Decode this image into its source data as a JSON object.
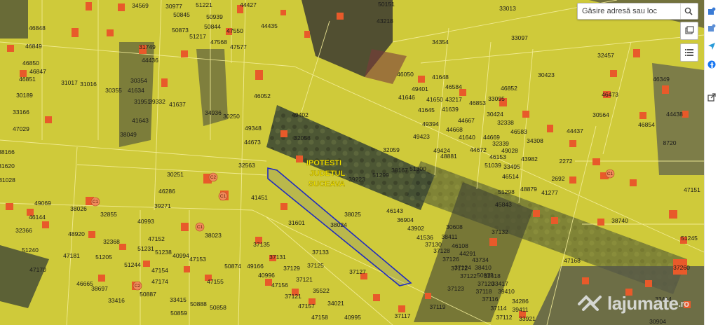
{
  "search": {
    "placeholder": "Găsire adresă sau loc"
  },
  "toolbar": {
    "search_icon": "search-icon",
    "layers_icon": "layers-icon",
    "list_icon": "list-icon"
  },
  "side_strip": {
    "icons": [
      "puzzle-icon",
      "send-icon",
      "facebook-icon",
      "external-link-icon"
    ]
  },
  "map": {
    "place_label": [
      "IPOTESTI",
      "JUDETUL",
      "SUCEAVA"
    ],
    "highlight_parcel": "31601",
    "highlight_color": "#1f2bbf",
    "parcel_fill": "#e8e43a",
    "parcel_line": "#fbf6a0",
    "building_color": "#e85a2a",
    "parcels": [
      {
        "id": "34569"
      },
      {
        "id": "30977"
      },
      {
        "id": "51221"
      },
      {
        "id": "44427"
      },
      {
        "id": "50151"
      },
      {
        "id": "33013"
      },
      {
        "id": "50845"
      },
      {
        "id": "50939"
      },
      {
        "id": "43218"
      },
      {
        "id": "46848"
      },
      {
        "id": "50873"
      },
      {
        "id": "50844"
      },
      {
        "id": "47550"
      },
      {
        "id": "44435"
      },
      {
        "id": "51217"
      },
      {
        "id": "33097"
      },
      {
        "id": "46849"
      },
      {
        "id": "47568"
      },
      {
        "id": "47577"
      },
      {
        "id": "34354"
      },
      {
        "id": "31749"
      },
      {
        "id": "32457"
      },
      {
        "id": "46850"
      },
      {
        "id": "44436"
      },
      {
        "id": "30423"
      },
      {
        "id": "46847"
      },
      {
        "id": "46050"
      },
      {
        "id": "41648"
      },
      {
        "id": "46349"
      },
      {
        "id": "46851"
      },
      {
        "id": "31017"
      },
      {
        "id": "31016"
      },
      {
        "id": "30354"
      },
      {
        "id": "41634"
      },
      {
        "id": "46584"
      },
      {
        "id": "46852"
      },
      {
        "id": "30189"
      },
      {
        "id": "30355"
      },
      {
        "id": "31951"
      },
      {
        "id": "46052"
      },
      {
        "id": "49401"
      },
      {
        "id": "41646"
      },
      {
        "id": "41650"
      },
      {
        "id": "43217"
      },
      {
        "id": "33095"
      },
      {
        "id": "46473"
      },
      {
        "id": "39332"
      },
      {
        "id": "41637"
      },
      {
        "id": "46853"
      },
      {
        "id": "33166"
      },
      {
        "id": "34936"
      },
      {
        "id": "30250"
      },
      {
        "id": "49402"
      },
      {
        "id": "41645"
      },
      {
        "id": "41639"
      },
      {
        "id": "30424"
      },
      {
        "id": "30564"
      },
      {
        "id": "44438"
      },
      {
        "id": "41643"
      },
      {
        "id": "44667"
      },
      {
        "id": "32338"
      },
      {
        "id": "46854"
      },
      {
        "id": "47029"
      },
      {
        "id": "49348"
      },
      {
        "id": "49394"
      },
      {
        "id": "44668"
      },
      {
        "id": "46583"
      },
      {
        "id": "44437"
      },
      {
        "id": "38049"
      },
      {
        "id": "32058"
      },
      {
        "id": "49423"
      },
      {
        "id": "41640"
      },
      {
        "id": "44669"
      },
      {
        "id": "34308"
      },
      {
        "id": "44673"
      },
      {
        "id": "32339"
      },
      {
        "id": "8720"
      },
      {
        "id": "38166"
      },
      {
        "id": "32059"
      },
      {
        "id": "49424"
      },
      {
        "id": "44672"
      },
      {
        "id": "49028"
      },
      {
        "id": "48881"
      },
      {
        "id": "46153"
      },
      {
        "id": "43982"
      },
      {
        "id": "2272"
      },
      {
        "id": "31620"
      },
      {
        "id": "32563"
      },
      {
        "id": "38167"
      },
      {
        "id": "51300"
      },
      {
        "id": "51039"
      },
      {
        "id": "33495"
      },
      {
        "id": "30251"
      },
      {
        "id": "51299"
      },
      {
        "id": "46514"
      },
      {
        "id": "2692"
      },
      {
        "id": "31028"
      },
      {
        "id": "39223"
      },
      {
        "id": "51298"
      },
      {
        "id": "48879"
      },
      {
        "id": "41277"
      },
      {
        "id": "47151"
      },
      {
        "id": "46286"
      },
      {
        "id": "41451"
      },
      {
        "id": "49069"
      },
      {
        "id": "39271"
      },
      {
        "id": "45843"
      },
      {
        "id": "38026"
      },
      {
        "id": "46143"
      },
      {
        "id": "32855"
      },
      {
        "id": "38025"
      },
      {
        "id": "36904"
      },
      {
        "id": "46144"
      },
      {
        "id": "40993"
      },
      {
        "id": "31601"
      },
      {
        "id": "38024"
      },
      {
        "id": "43902"
      },
      {
        "id": "30608"
      },
      {
        "id": "38740"
      },
      {
        "id": "32366"
      },
      {
        "id": "48920"
      },
      {
        "id": "38023"
      },
      {
        "id": "41536"
      },
      {
        "id": "37132"
      },
      {
        "id": "38411"
      },
      {
        "id": "51245"
      },
      {
        "id": "32368"
      },
      {
        "id": "47152"
      },
      {
        "id": "37135"
      },
      {
        "id": "37130"
      },
      {
        "id": "46108"
      },
      {
        "id": "51240"
      },
      {
        "id": "51231"
      },
      {
        "id": "51238"
      },
      {
        "id": "40994"
      },
      {
        "id": "37133"
      },
      {
        "id": "37128"
      },
      {
        "id": "44291"
      },
      {
        "id": "47181"
      },
      {
        "id": "51205"
      },
      {
        "id": "47153"
      },
      {
        "id": "37131"
      },
      {
        "id": "37126"
      },
      {
        "id": "43734"
      },
      {
        "id": "47168"
      },
      {
        "id": "51244"
      },
      {
        "id": "50874"
      },
      {
        "id": "49166"
      },
      {
        "id": "37125"
      },
      {
        "id": "37124"
      },
      {
        "id": "38410"
      },
      {
        "id": "37260"
      },
      {
        "id": "47170"
      },
      {
        "id": "47154"
      },
      {
        "id": "37129"
      },
      {
        "id": "37172"
      },
      {
        "id": "50875"
      },
      {
        "id": "40996"
      },
      {
        "id": "37127"
      },
      {
        "id": "37122"
      },
      {
        "id": "33418"
      },
      {
        "id": "46665"
      },
      {
        "id": "47174"
      },
      {
        "id": "47155"
      },
      {
        "id": "37121"
      },
      {
        "id": "37120"
      },
      {
        "id": "33417"
      },
      {
        "id": "38697"
      },
      {
        "id": "50887"
      },
      {
        "id": "47156"
      },
      {
        "id": "35522"
      },
      {
        "id": "37123"
      },
      {
        "id": "37118"
      },
      {
        "id": "39410"
      },
      {
        "id": "33416"
      },
      {
        "id": "33415"
      },
      {
        "id": "50888"
      },
      {
        "id": "37121"
      },
      {
        "id": "37116"
      },
      {
        "id": "34286"
      },
      {
        "id": "33414"
      },
      {
        "id": "50858"
      },
      {
        "id": "47157"
      },
      {
        "id": "34021"
      },
      {
        "id": "37119"
      },
      {
        "id": "37114"
      },
      {
        "id": "39411"
      },
      {
        "id": "50859"
      },
      {
        "id": "47158"
      },
      {
        "id": "40995"
      },
      {
        "id": "37117"
      },
      {
        "id": "37112"
      },
      {
        "id": "33921"
      },
      {
        "id": "30904"
      }
    ],
    "building_markers": [
      "C2",
      "C1",
      "C1",
      "C1",
      "C2",
      "C1"
    ]
  },
  "watermark": {
    "text": "lajumate",
    "suffix": ".ro"
  }
}
